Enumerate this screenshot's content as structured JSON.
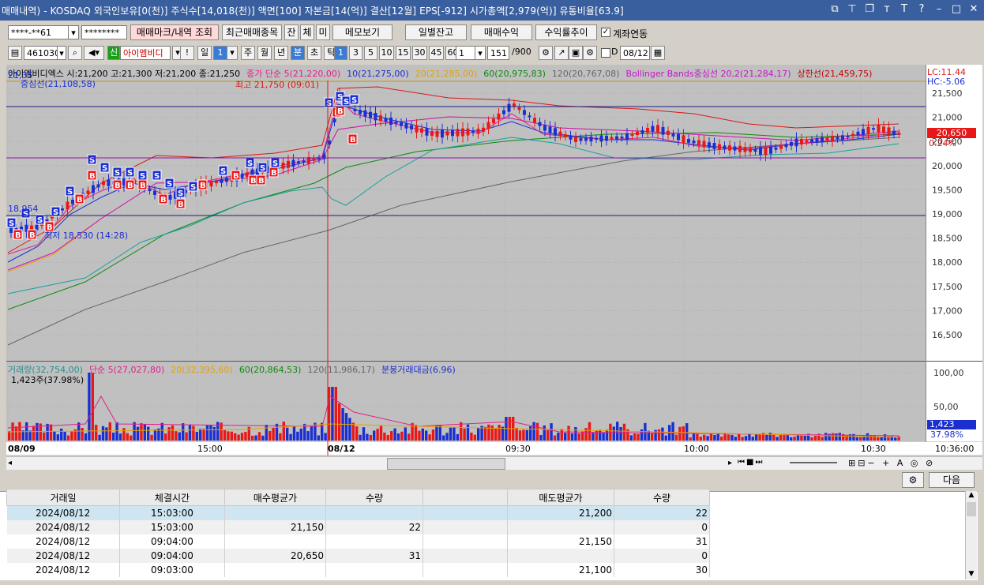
{
  "title": "매매내역) - KOSDAQ 외국인보유[0(천)] 주식수[14,018(천)] 액면[100] 자본금[14(억)] 결산[12월] EPS[-912] 시가총액[2,979(억)] 유통비율[63.9]",
  "toolbar1": {
    "account": "****-**61",
    "password": "********",
    "btn_trade_mark": "매매마크/내역 조회",
    "btn_recent": "최근매매종목",
    "btn_jan": "잔",
    "btn_che": "체",
    "btn_mi": "미",
    "btn_memo": "메모보기",
    "btn_daily_balance": "일별잔고",
    "btn_trade_profit": "매매수익",
    "btn_return": "수익률추이",
    "chk_account_link": "계좌연동"
  },
  "toolbar2": {
    "code": "461030",
    "badge": "신",
    "name": "아이엠비디",
    "excl": "!",
    "period_day": "일",
    "period_num": "1",
    "periods": [
      "주",
      "월",
      "년",
      "분",
      "초",
      "틱"
    ],
    "selected_period": "분",
    "intervals": [
      "1",
      "3",
      "5",
      "10",
      "15",
      "30",
      "45",
      "60"
    ],
    "selected_interval": "1",
    "count_select": "1",
    "count": "151",
    "count_total": "/900",
    "chk_d": "D",
    "date": "08/12"
  },
  "main_chart": {
    "legend": [
      {
        "text": "아이엠비디엑스 시:21,200 고:21,300 저:21,200 종:21,250",
        "color": "#000000"
      },
      {
        "text": "종가 단순 5(21,220,00)",
        "color": "#e0218a"
      },
      {
        "text": "10(21,275,00)",
        "color": "#1b2fd1"
      },
      {
        "text": "20(21,285,00)",
        "color": "#e6a100"
      },
      {
        "text": "60(20,975,83)",
        "color": "#0c8a0c"
      },
      {
        "text": "120(20,767,08)",
        "color": "#666666"
      },
      {
        "text": "Bollinger Bands중심선 20,2(21,284,17)",
        "color": "#c814c8"
      },
      {
        "text": "상한선(21,459,75)",
        "color": "#c80000"
      }
    ],
    "lc": "LC:11.44",
    "hc": "HC:-5.06",
    "current_price": "20,650",
    "current_pct": "0.24%",
    "high_label": "최고 21,750 (09:01)",
    "low_label": "최저 18,530 (14:28)",
    "left_value_top": "21,35",
    "left_value_mid": "18,954",
    "center_line_label": "중심선(21,108,58)",
    "y_axis": [
      "21,500",
      "21,000",
      "20,500",
      "20,000",
      "19,500",
      "19,000",
      "18,500",
      "18,000",
      "17,500",
      "17,000",
      "16,500"
    ]
  },
  "volume_chart": {
    "legend": [
      {
        "text": "거래량(32,754,00)",
        "color": "#2a8f8f"
      },
      {
        "text": "단순 5(27,027,80)",
        "color": "#e0218a"
      },
      {
        "text": "20(32,395,60)",
        "color": "#e6a100"
      },
      {
        "text": "60(20,864,53)",
        "color": "#0c8a0c"
      },
      {
        "text": "120(11,986,17)",
        "color": "#666666"
      },
      {
        "text": "분봉거래대금(6.96)",
        "color": "#1b2fd1"
      }
    ],
    "sub": "1,423주(37.98%)",
    "y_axis": [
      "100,00",
      "50,00"
    ],
    "current_vol": "1,423",
    "current_pct": "37.98%"
  },
  "x_axis": [
    "08/09",
    "15:00",
    "08/12",
    "09:30",
    "10:00",
    "10:30",
    "10:36:00"
  ],
  "bottom_btn_next": "다음",
  "table": {
    "headers": [
      "거래일",
      "체결시간",
      "매수평균가",
      "수량",
      "",
      "매도평균가",
      "수량"
    ],
    "rows": [
      [
        "2024/08/12",
        "15:03:00",
        "",
        "",
        "",
        "21,200",
        "22"
      ],
      [
        "2024/08/12",
        "15:03:00",
        "21,150",
        "22",
        "",
        "",
        "0"
      ],
      [
        "2024/08/12",
        "09:04:00",
        "",
        "",
        "",
        "21,150",
        "31"
      ],
      [
        "2024/08/12",
        "09:04:00",
        "20,650",
        "31",
        "",
        "",
        "0"
      ],
      [
        "2024/08/12",
        "09:03:00",
        "",
        "",
        "",
        "21,100",
        "30"
      ]
    ]
  }
}
